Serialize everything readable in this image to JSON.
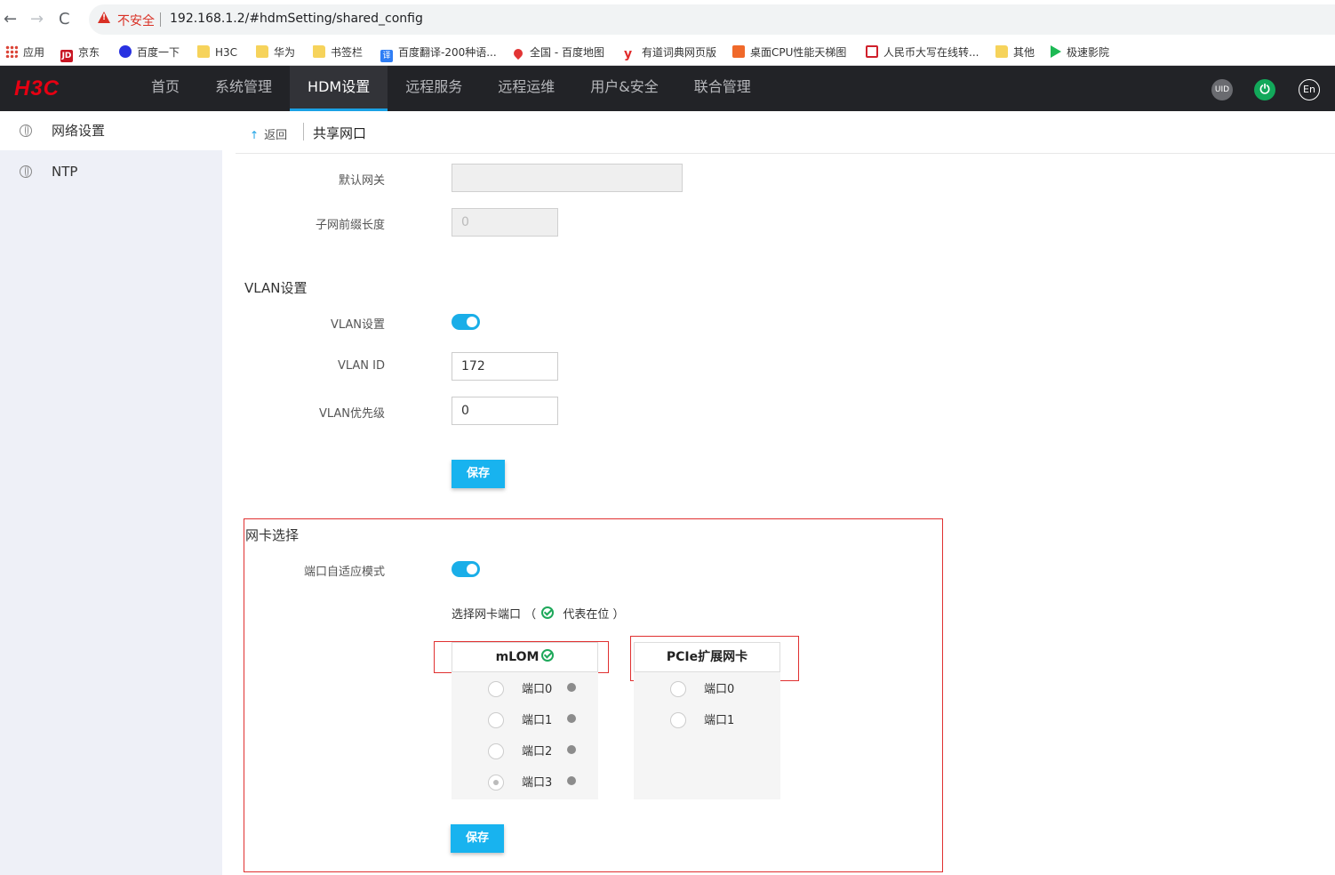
{
  "browser": {
    "back_icon": "←",
    "forward_icon": "→",
    "reload_icon": "C",
    "security_label": "不安全",
    "url": "192.168.1.2/#hdmSetting/shared_config",
    "bookmarks": [
      {
        "label": "应用",
        "icon": "apps-icon"
      },
      {
        "label": "京东",
        "icon": "jd-icon",
        "glyph": "JD"
      },
      {
        "label": "百度一下",
        "icon": "baidu-icon"
      },
      {
        "label": "H3C",
        "icon": "folder-icon"
      },
      {
        "label": "华为",
        "icon": "folder-icon"
      },
      {
        "label": "书签栏",
        "icon": "folder-icon"
      },
      {
        "label": "百度翻译-200种语...",
        "icon": "fanyi-icon",
        "glyph": "译"
      },
      {
        "label": "全国 - 百度地图",
        "icon": "map-pin-icon"
      },
      {
        "label": "有道词典网页版",
        "icon": "youdao-icon",
        "glyph": "y"
      },
      {
        "label": "桌面CPU性能天梯图",
        "icon": "cpu-icon"
      },
      {
        "label": "人民币大写在线转...",
        "icon": "rmb-icon"
      },
      {
        "label": "其他",
        "icon": "folder-icon"
      },
      {
        "label": "极速影院",
        "icon": "play-icon"
      }
    ]
  },
  "header": {
    "logo": "H3C",
    "nav": [
      {
        "label": "首页",
        "active": false
      },
      {
        "label": "系统管理",
        "active": false
      },
      {
        "label": "HDM设置",
        "active": true
      },
      {
        "label": "远程服务",
        "active": false
      },
      {
        "label": "远程运维",
        "active": false
      },
      {
        "label": "用户&安全",
        "active": false
      },
      {
        "label": "联合管理",
        "active": false
      }
    ],
    "uid_label": "UID",
    "power_glyph": "⏻",
    "lang_label": "En",
    "accent_color": "#1aa1e5"
  },
  "sidebar": {
    "items": [
      {
        "label": "网络设置",
        "active": true
      },
      {
        "label": "NTP",
        "active": false
      }
    ]
  },
  "breadcrumb": {
    "back_icon": "↑",
    "back_label": "返回",
    "title": "共享网口"
  },
  "ipv4": {
    "gateway_label": "默认网关",
    "gateway_value": "",
    "prefix_label": "子网前缀长度",
    "prefix_value": "0"
  },
  "vlan": {
    "section_title": "VLAN设置",
    "toggle_label": "VLAN设置",
    "toggle_on": true,
    "id_label": "VLAN ID",
    "id_value": "172",
    "priority_label": "VLAN优先级",
    "priority_value": "0",
    "save_label": "保存"
  },
  "nic": {
    "section_title": "网卡选择",
    "adaptive_label": "端口自适应模式",
    "adaptive_on": true,
    "select_prefix": "选择网卡端口 （",
    "select_suffix": "代表在位 ）",
    "mlom": {
      "title": "mLOM",
      "present": true,
      "ports": [
        {
          "label": "端口0",
          "checked": false
        },
        {
          "label": "端口1",
          "checked": false
        },
        {
          "label": "端口2",
          "checked": false
        },
        {
          "label": "端口3",
          "checked": true
        }
      ]
    },
    "pcie": {
      "title": "PCIe扩展网卡",
      "ports": [
        {
          "label": "端口0",
          "checked": false
        },
        {
          "label": "端口1",
          "checked": false
        }
      ]
    },
    "save_label": "保存",
    "highlight_color": "#e03030"
  }
}
